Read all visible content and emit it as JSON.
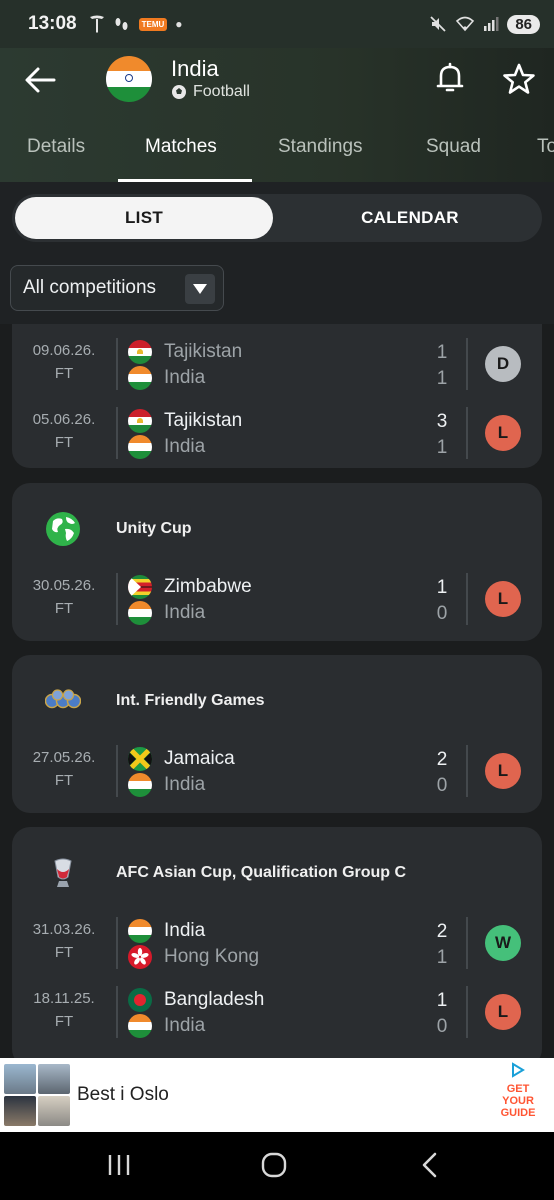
{
  "status_bar": {
    "time": "13:08",
    "battery": "86",
    "temu_label": "TEMU"
  },
  "header": {
    "team_name": "India",
    "sport": "Football"
  },
  "tabs": [
    {
      "label": "Details"
    },
    {
      "label": "Matches"
    },
    {
      "label": "Standings"
    },
    {
      "label": "Squad"
    },
    {
      "label": "To"
    }
  ],
  "view_toggle": {
    "list_label": "LIST",
    "calendar_label": "CALENDAR",
    "selected": "LIST"
  },
  "filter": {
    "value": "All competitions"
  },
  "competitions": [
    {
      "name": "",
      "matches": [
        {
          "date": "09.06.26.",
          "status": "FT",
          "home": "Tajikistan",
          "away": "India",
          "home_score": "1",
          "away_score": "1",
          "result": "D"
        },
        {
          "date": "05.06.26.",
          "status": "FT",
          "home": "Tajikistan",
          "away": "India",
          "home_score": "3",
          "away_score": "1",
          "result": "L"
        }
      ]
    },
    {
      "name": "Unity Cup",
      "logo": "globe-icon",
      "matches": [
        {
          "date": "30.05.26.",
          "status": "FT",
          "home": "Zimbabwe",
          "away": "India",
          "home_score": "1",
          "away_score": "0",
          "result": "L"
        }
      ]
    },
    {
      "name": "Int. Friendly Games",
      "logo": "balls-icon",
      "matches": [
        {
          "date": "27.05.26.",
          "status": "FT",
          "home": "Jamaica",
          "away": "India",
          "home_score": "2",
          "away_score": "0",
          "result": "L"
        }
      ]
    },
    {
      "name": "AFC Asian Cup, Qualification Group C",
      "logo": "trophy-icon",
      "matches": [
        {
          "date": "31.03.26.",
          "status": "FT",
          "home": "India",
          "away": "Hong Kong",
          "home_score": "2",
          "away_score": "1",
          "result": "W"
        },
        {
          "date": "18.11.25.",
          "status": "FT",
          "home": "Bangladesh",
          "away": "India",
          "home_score": "1",
          "away_score": "0",
          "result": "L"
        }
      ]
    }
  ],
  "ad": {
    "text": "Best i Oslo",
    "brand": "GET YOUR GUIDE"
  },
  "colors": {
    "loss": "#e0654f",
    "draw": "#b8bcc0",
    "win": "#45c07a",
    "background": "#1b1d1e",
    "card": "#2a2d30"
  }
}
